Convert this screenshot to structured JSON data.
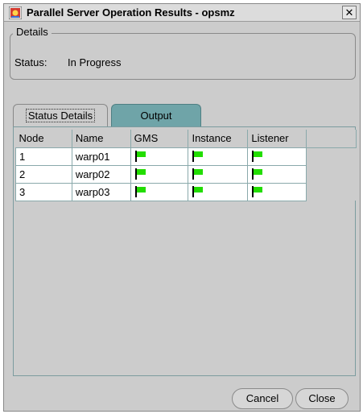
{
  "window": {
    "title": "Parallel Server Operation Results - opsmz",
    "close_glyph": "✕"
  },
  "details": {
    "legend": "Details",
    "status_label": "Status:",
    "status_value": "In Progress"
  },
  "tabs": [
    {
      "label": "Status Details",
      "selected": true
    },
    {
      "label": "Output",
      "selected": false
    }
  ],
  "table": {
    "columns": [
      "Node",
      "Name",
      "GMS",
      "Instance",
      "Listener"
    ],
    "rows": [
      {
        "node": "1",
        "name": "warp01",
        "gms": "green-flag-icon",
        "instance": "green-flag-icon",
        "listener": "green-flag-icon"
      },
      {
        "node": "2",
        "name": "warp02",
        "gms": "green-flag-icon",
        "instance": "green-flag-icon",
        "listener": "green-flag-icon"
      },
      {
        "node": "3",
        "name": "warp03",
        "gms": "green-flag-icon",
        "instance": "green-flag-icon",
        "listener": "green-flag-icon"
      }
    ]
  },
  "buttons": {
    "cancel": "Cancel",
    "close": "Close"
  },
  "colors": {
    "window_bg": "#cccccc",
    "tab_active_teal": "#6fa4a8",
    "flag_green": "#22dd00",
    "grid_line": "#8aa9ab"
  }
}
